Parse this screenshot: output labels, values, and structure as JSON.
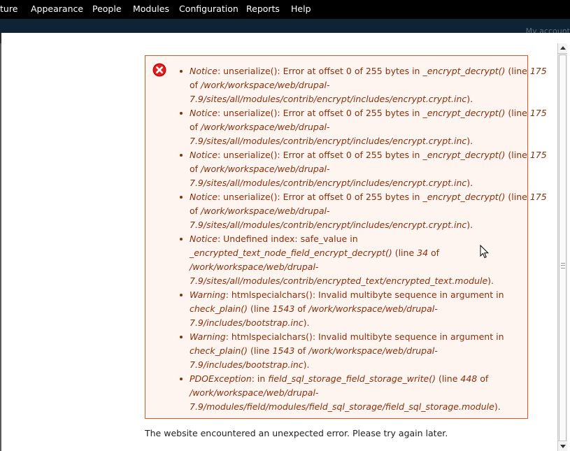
{
  "toolbar": {
    "items": [
      "ture",
      "Appearance",
      "People",
      "Modules",
      "Configuration",
      "Reports",
      "Help"
    ],
    "account_link": "My account"
  },
  "messages": {
    "icon": "error-icon",
    "items": [
      {
        "type": "Notice",
        "lines": [
          {
            "parts": [
              {
                "t": "Notice",
                "i": true
              },
              {
                "t": ": unserialize(): Error at offset 0 of 255 bytes in "
              },
              {
                "t": "_encrypt_decrypt()",
                "i": true
              },
              {
                "t": " (line "
              },
              {
                "t": "175",
                "i": true
              }
            ]
          },
          {
            "parts": [
              {
                "t": "of "
              },
              {
                "t": "/work/workspace/web/drupal-",
                "i": true
              }
            ]
          },
          {
            "parts": [
              {
                "t": "7.9/sites/all/modules/contrib/encrypt/includes/encrypt.crypt.inc",
                "i": true
              },
              {
                "t": ")."
              }
            ]
          }
        ]
      },
      {
        "type": "Notice",
        "lines": [
          {
            "parts": [
              {
                "t": "Notice",
                "i": true
              },
              {
                "t": ": unserialize(): Error at offset 0 of 255 bytes in "
              },
              {
                "t": "_encrypt_decrypt()",
                "i": true
              },
              {
                "t": " (line "
              },
              {
                "t": "175",
                "i": true
              }
            ]
          },
          {
            "parts": [
              {
                "t": "of "
              },
              {
                "t": "/work/workspace/web/drupal-",
                "i": true
              }
            ]
          },
          {
            "parts": [
              {
                "t": "7.9/sites/all/modules/contrib/encrypt/includes/encrypt.crypt.inc",
                "i": true
              },
              {
                "t": ")."
              }
            ]
          }
        ]
      },
      {
        "type": "Notice",
        "lines": [
          {
            "parts": [
              {
                "t": "Notice",
                "i": true
              },
              {
                "t": ": unserialize(): Error at offset 0 of 255 bytes in "
              },
              {
                "t": "_encrypt_decrypt()",
                "i": true
              },
              {
                "t": " (line "
              },
              {
                "t": "175",
                "i": true
              }
            ]
          },
          {
            "parts": [
              {
                "t": "of "
              },
              {
                "t": "/work/workspace/web/drupal-",
                "i": true
              }
            ]
          },
          {
            "parts": [
              {
                "t": "7.9/sites/all/modules/contrib/encrypt/includes/encrypt.crypt.inc",
                "i": true
              },
              {
                "t": ")."
              }
            ]
          }
        ]
      },
      {
        "type": "Notice",
        "lines": [
          {
            "parts": [
              {
                "t": "Notice",
                "i": true
              },
              {
                "t": ": unserialize(): Error at offset 0 of 255 bytes in "
              },
              {
                "t": "_encrypt_decrypt()",
                "i": true
              },
              {
                "t": " (line "
              },
              {
                "t": "175",
                "i": true
              }
            ]
          },
          {
            "parts": [
              {
                "t": "of "
              },
              {
                "t": "/work/workspace/web/drupal-",
                "i": true
              }
            ]
          },
          {
            "parts": [
              {
                "t": "7.9/sites/all/modules/contrib/encrypt/includes/encrypt.crypt.inc",
                "i": true
              },
              {
                "t": ")."
              }
            ]
          }
        ]
      },
      {
        "type": "Notice",
        "lines": [
          {
            "parts": [
              {
                "t": "Notice",
                "i": true
              },
              {
                "t": ": Undefined index: safe_value in"
              }
            ]
          },
          {
            "parts": [
              {
                "t": "_encrypted_text_node_field_encrypt_decrypt()",
                "i": true
              },
              {
                "t": " (line "
              },
              {
                "t": "34",
                "i": true
              },
              {
                "t": " of"
              }
            ]
          },
          {
            "parts": [
              {
                "t": "/work/workspace/web/drupal-",
                "i": true
              }
            ]
          },
          {
            "parts": [
              {
                "t": "7.9/sites/all/modules/contrib/encrypted_text/encrypted_text.module",
                "i": true
              },
              {
                "t": ")."
              }
            ]
          }
        ]
      },
      {
        "type": "Warning",
        "lines": [
          {
            "parts": [
              {
                "t": "Warning",
                "i": true
              },
              {
                "t": ": htmlspecialchars(): Invalid multibyte sequence in argument in"
              }
            ]
          },
          {
            "parts": [
              {
                "t": "check_plain()",
                "i": true
              },
              {
                "t": " (line "
              },
              {
                "t": "1543",
                "i": true
              },
              {
                "t": " of "
              },
              {
                "t": "/work/workspace/web/drupal-",
                "i": true
              }
            ]
          },
          {
            "parts": [
              {
                "t": "7.9/includes/bootstrap.inc",
                "i": true
              },
              {
                "t": ")."
              }
            ]
          }
        ]
      },
      {
        "type": "Warning",
        "lines": [
          {
            "parts": [
              {
                "t": "Warning",
                "i": true
              },
              {
                "t": ": htmlspecialchars(): Invalid multibyte sequence in argument in"
              }
            ]
          },
          {
            "parts": [
              {
                "t": "check_plain()",
                "i": true
              },
              {
                "t": " (line "
              },
              {
                "t": "1543",
                "i": true
              },
              {
                "t": " of "
              },
              {
                "t": "/work/workspace/web/drupal-",
                "i": true
              }
            ]
          },
          {
            "parts": [
              {
                "t": "7.9/includes/bootstrap.inc",
                "i": true
              },
              {
                "t": ")."
              }
            ]
          }
        ]
      },
      {
        "type": "PDOException",
        "lines": [
          {
            "parts": [
              {
                "t": "PDOException",
                "i": true
              },
              {
                "t": ": in "
              },
              {
                "t": "field_sql_storage_field_storage_write()",
                "i": true
              },
              {
                "t": " (line "
              },
              {
                "t": "448",
                "i": true
              },
              {
                "t": " of"
              }
            ]
          },
          {
            "parts": [
              {
                "t": "/work/workspace/web/drupal-",
                "i": true
              }
            ]
          },
          {
            "parts": [
              {
                "t": "7.9/modules/field/modules/field_sql_storage/field_sql_storage.module",
                "i": true
              },
              {
                "t": ")."
              }
            ]
          }
        ]
      }
    ]
  },
  "main": {
    "error_message": "The website encountered an unexpected error. Please try again later."
  },
  "colors": {
    "toolbar_bg": "#000000",
    "shortcut_bg": "#0e2434",
    "error_text": "#8c2e0b",
    "error_border": "#ed541d",
    "error_bg": "#fef5f1",
    "error_icon": "#cc0000"
  }
}
